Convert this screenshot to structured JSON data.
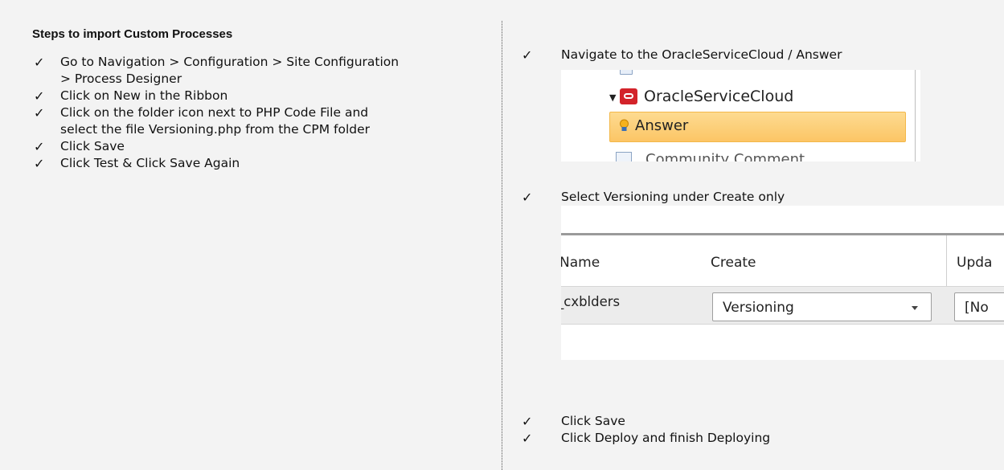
{
  "left": {
    "heading": "Steps to import Custom Processes",
    "check_glyph": "✓",
    "steps": [
      {
        "lines": [
          "Go to Navigation > Configuration > Site Configuration",
          "> Process Designer"
        ]
      },
      {
        "lines": [
          "Click on New in the Ribbon"
        ]
      },
      {
        "lines": [
          "Click on the folder icon next to PHP Code File and",
          "select the file Versioning.php from the CPM folder"
        ]
      },
      {
        "lines": [
          "Click Save"
        ]
      },
      {
        "lines": [
          "Click Test & Click Save Again"
        ]
      }
    ]
  },
  "right": {
    "step1": "Navigate to the OracleServiceCloud / Answer",
    "tree": {
      "node_label": "OracleServiceCloud",
      "selected_label": "Answer",
      "cut_label": "Community Comment",
      "selected_color": "#fcd27b",
      "node_icon": "oracle-icon",
      "selected_icon": "bulb-icon"
    },
    "step2": "Select Versioning under Create only",
    "grid": {
      "col_name": "Name",
      "col_create": "Create",
      "col_update": "Upda",
      "row_name": "_cxblders",
      "create_value": "Versioning",
      "update_value": "[No"
    },
    "step3": "Click Save",
    "step4": "Click Deploy and finish Deploying"
  }
}
